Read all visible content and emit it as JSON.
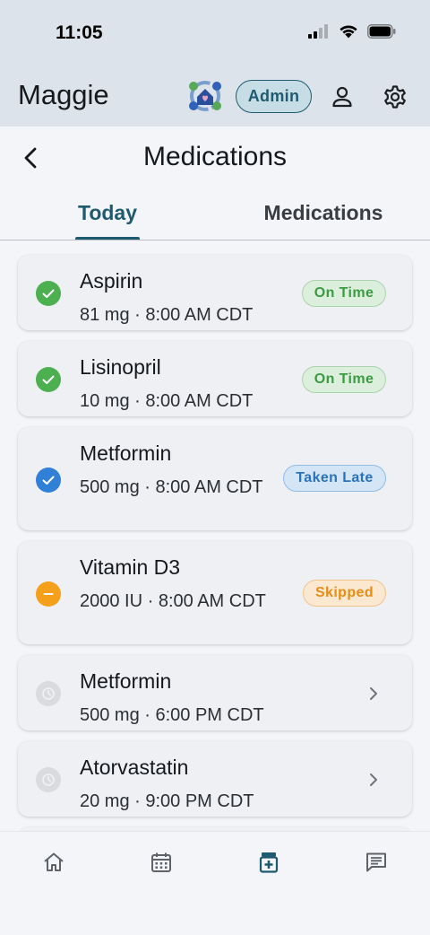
{
  "status_bar": {
    "time": "11:05"
  },
  "header": {
    "title": "Maggie",
    "role_badge": "Admin"
  },
  "page": {
    "title": "Medications"
  },
  "tabs": [
    {
      "label": "Today",
      "active": true
    },
    {
      "label": "Medications",
      "active": false
    }
  ],
  "doses": [
    {
      "name": "Aspirin",
      "detail": "81 mg · 8:00 AM CDT",
      "status": "On Time",
      "state": "on-time"
    },
    {
      "name": "Lisinopril",
      "detail": "10 mg · 8:00 AM CDT",
      "status": "On Time",
      "state": "on-time"
    },
    {
      "name": "Metformin",
      "detail": "500 mg · 8:00 AM CDT",
      "status": "Taken Late",
      "state": "late"
    },
    {
      "name": "Vitamin D3",
      "detail": "2000 IU · 8:00 AM CDT",
      "status": "Skipped",
      "state": "skipped"
    },
    {
      "name": "Metformin",
      "detail": "500 mg · 6:00 PM CDT",
      "status": "",
      "state": "pending"
    },
    {
      "name": "Atorvastatin",
      "detail": "20 mg · 9:00 PM CDT",
      "status": "",
      "state": "pending"
    }
  ],
  "bottom_nav": [
    {
      "icon": "home-icon",
      "active": false
    },
    {
      "icon": "calendar-icon",
      "active": false
    },
    {
      "icon": "medication-icon",
      "active": true
    },
    {
      "icon": "message-icon",
      "active": false
    }
  ],
  "colors": {
    "primary": "#1e5a70",
    "on_time": "#4caf50",
    "late": "#2f80d6",
    "skipped": "#f5a01a",
    "pending": "#d9dbde"
  }
}
